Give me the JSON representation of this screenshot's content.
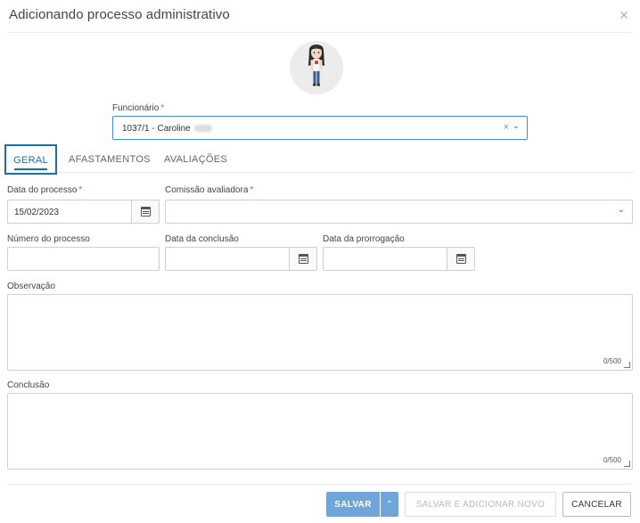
{
  "dialog": {
    "title": "Adicionando processo administrativo",
    "close_icon": "close-icon"
  },
  "employee": {
    "label": "Funcionário",
    "required_mark": "*",
    "value": "1037/1 - Caroline",
    "clear_symbol": "×",
    "chevron_symbol": "⌄"
  },
  "tabs": [
    {
      "label": "GERAL",
      "active": true
    },
    {
      "label": "AFASTAMENTOS",
      "active": false
    },
    {
      "label": "AVALIAÇÕES",
      "active": false
    }
  ],
  "form": {
    "data_processo": {
      "label": "Data do processo",
      "required_mark": "*",
      "value": "15/02/2023"
    },
    "comissao": {
      "label": "Comissão avaliadora",
      "required_mark": "*",
      "value": ""
    },
    "numero_processo": {
      "label": "Número do processo",
      "value": ""
    },
    "data_conclusao": {
      "label": "Data da conclusão",
      "value": ""
    },
    "data_prorrogacao": {
      "label": "Data da prorrogação",
      "value": ""
    },
    "observacao": {
      "label": "Observação",
      "counter": "0/500"
    },
    "conclusao": {
      "label": "Conclusão",
      "counter": "0/500"
    }
  },
  "footer": {
    "save_label": "SALVAR",
    "save_menu_symbol": "⌃",
    "save_new_label": "SALVAR E ADICIONAR NOVO",
    "cancel_label": "CANCELAR"
  },
  "colors": {
    "primary": "#1a6fa5",
    "save_button": "#6fa5d8",
    "required": "#d9534f"
  }
}
